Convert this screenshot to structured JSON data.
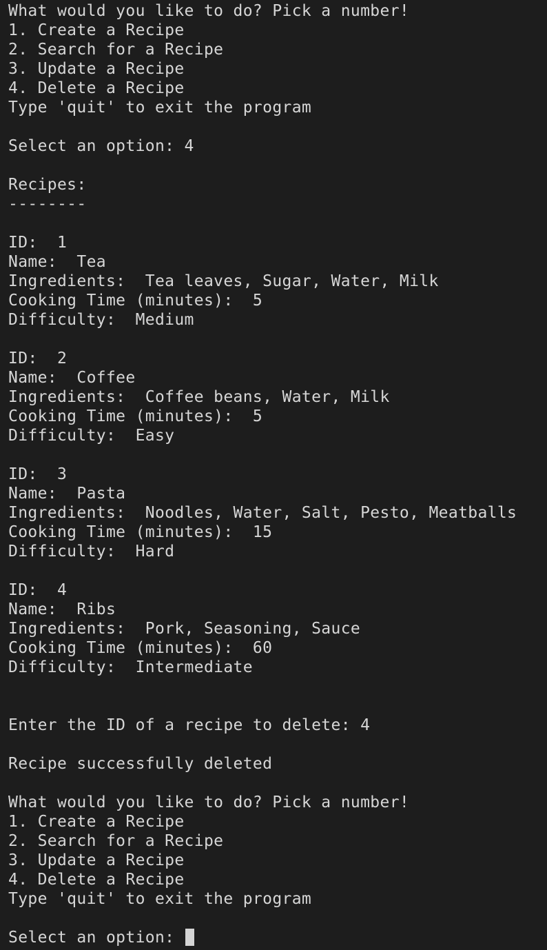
{
  "colors": {
    "background": "#1d1d1d",
    "foreground": "#d6d6d6",
    "cursor": "#d4d4d4"
  },
  "terminal": {
    "lines": [
      "What would you like to do? Pick a number!",
      "1. Create a Recipe",
      "2. Search for a Recipe",
      "3. Update a Recipe",
      "4. Delete a Recipe",
      "Type 'quit' to exit the program",
      "",
      "Select an option: 4",
      "",
      "Recipes:",
      "--------",
      "",
      "ID:  1",
      "Name:  Tea",
      "Ingredients:  Tea leaves, Sugar, Water, Milk",
      "Cooking Time (minutes):  5",
      "Difficulty:  Medium",
      "",
      "ID:  2",
      "Name:  Coffee",
      "Ingredients:  Coffee beans, Water, Milk",
      "Cooking Time (minutes):  5",
      "Difficulty:  Easy",
      "",
      "ID:  3",
      "Name:  Pasta",
      "Ingredients:  Noodles, Water, Salt, Pesto, Meatballs",
      "Cooking Time (minutes):  15",
      "Difficulty:  Hard",
      "",
      "ID:  4",
      "Name:  Ribs",
      "Ingredients:  Pork, Seasoning, Sauce",
      "Cooking Time (minutes):  60",
      "Difficulty:  Intermediate",
      "",
      "",
      "Enter the ID of a recipe to delete: 4",
      "",
      "Recipe successfully deleted",
      "",
      "What would you like to do? Pick a number!",
      "1. Create a Recipe",
      "2. Search for a Recipe",
      "3. Update a Recipe",
      "4. Delete a Recipe",
      "Type 'quit' to exit the program",
      ""
    ],
    "prompt": "Select an option: "
  }
}
